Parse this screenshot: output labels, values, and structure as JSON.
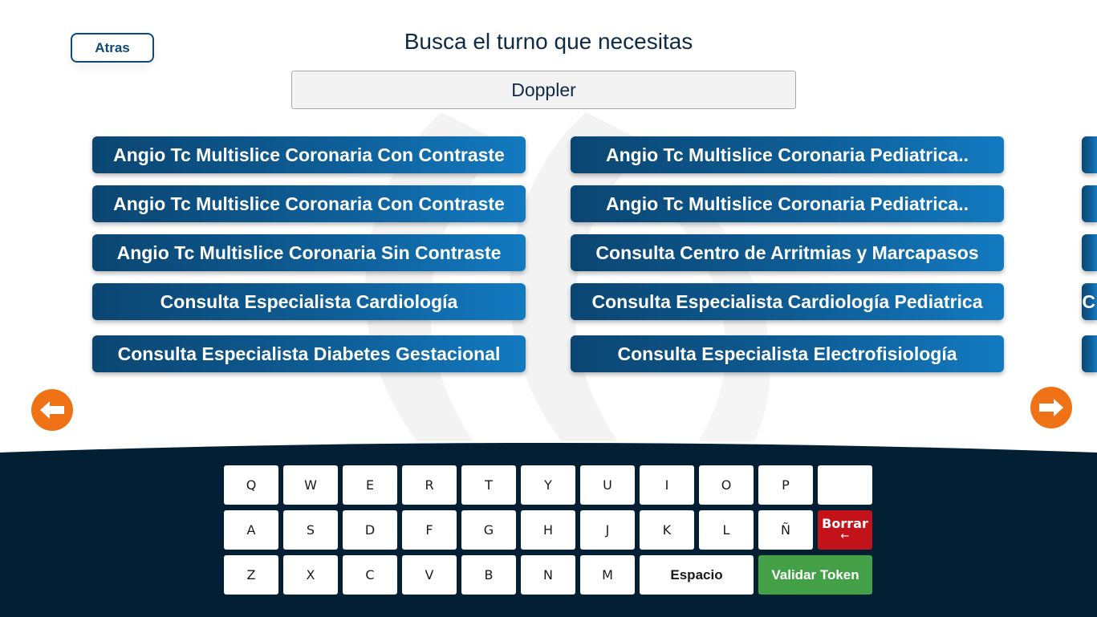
{
  "header": {
    "back_label": "Atras",
    "title": "Busca el turno que necesitas"
  },
  "search": {
    "value": "Doppler"
  },
  "services": {
    "col1": [
      "Angio Tc Multislice Coronaria Con Contraste",
      "Angio Tc Multislice Coronaria Con Contraste",
      "Angio Tc Multislice Coronaria Sin Contraste",
      "Consulta Especialista Cardiología",
      "Consulta Especialista Diabetes Gestacional"
    ],
    "col2": [
      "Angio Tc Multislice Coronaria Pediatrica..",
      "Angio Tc Multislice Coronaria Pediatrica..",
      "Consulta Centro de Arritmias y Marcapasos",
      "Consulta Especialista Cardiología Pediatrica",
      "Consulta Especialista Electrofisiología"
    ],
    "col3": [
      "",
      "",
      "",
      "C",
      ""
    ]
  },
  "navigation": {
    "prev_icon": "arrow-left-icon",
    "next_icon": "arrow-right-icon"
  },
  "keyboard": {
    "row1": [
      "Q",
      "W",
      "E",
      "R",
      "T",
      "Y",
      "U",
      "I",
      "O",
      "P",
      ""
    ],
    "row2": [
      "A",
      "S",
      "D",
      "F",
      "G",
      "H",
      "J",
      "K",
      "L",
      "Ñ"
    ],
    "row3": [
      "Z",
      "X",
      "C",
      "V",
      "B",
      "N",
      "M"
    ],
    "borrar_label": "Borrar",
    "borrar_arrow": "←",
    "space_label": "Espacio",
    "validate_label": "Validar Token"
  },
  "colors": {
    "brand_dark": "#0d2a47",
    "button_blue": "#0e5d96",
    "arrow_orange": "#f07216",
    "keyboard_bg": "#021f33",
    "delete_red": "#c4121a",
    "validate_green": "#43a047"
  }
}
